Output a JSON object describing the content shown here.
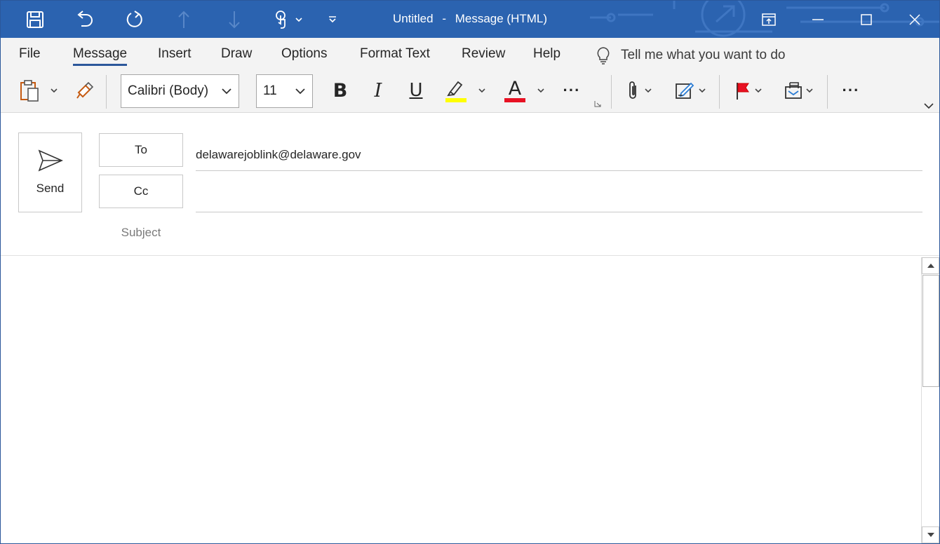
{
  "window": {
    "title": "Untitled",
    "title_sep": "-",
    "title_suffix": "Message (HTML)"
  },
  "qat": {
    "save_icon": "save-icon",
    "undo_icon": "undo-icon",
    "redo_icon": "redo-icon",
    "prev_icon": "arrow-up-icon",
    "next_icon": "arrow-down-icon",
    "touch_icon": "touch-mode-icon",
    "customize_icon": "customize-qat-icon"
  },
  "tabs": [
    "File",
    "Message",
    "Insert",
    "Draw",
    "Options",
    "Format Text",
    "Review",
    "Help"
  ],
  "active_tab": "Message",
  "tell_me": "Tell me what you want to do",
  "ribbon": {
    "font_name": "Calibri (Body)",
    "font_size": "11",
    "bold": "B",
    "italic": "I",
    "underline": "U",
    "font_color_letter": "A",
    "more": "···",
    "highlight_color": "#ffff00",
    "font_color": "#e81123"
  },
  "compose": {
    "send_label": "Send",
    "to_label": "To",
    "cc_label": "Cc",
    "subject_label": "Subject",
    "to_value": "delawarejoblink@delaware.gov",
    "cc_value": "",
    "subject_value": ""
  },
  "colors": {
    "titlebar": "#2b63b0",
    "accent": "#2b579a"
  }
}
